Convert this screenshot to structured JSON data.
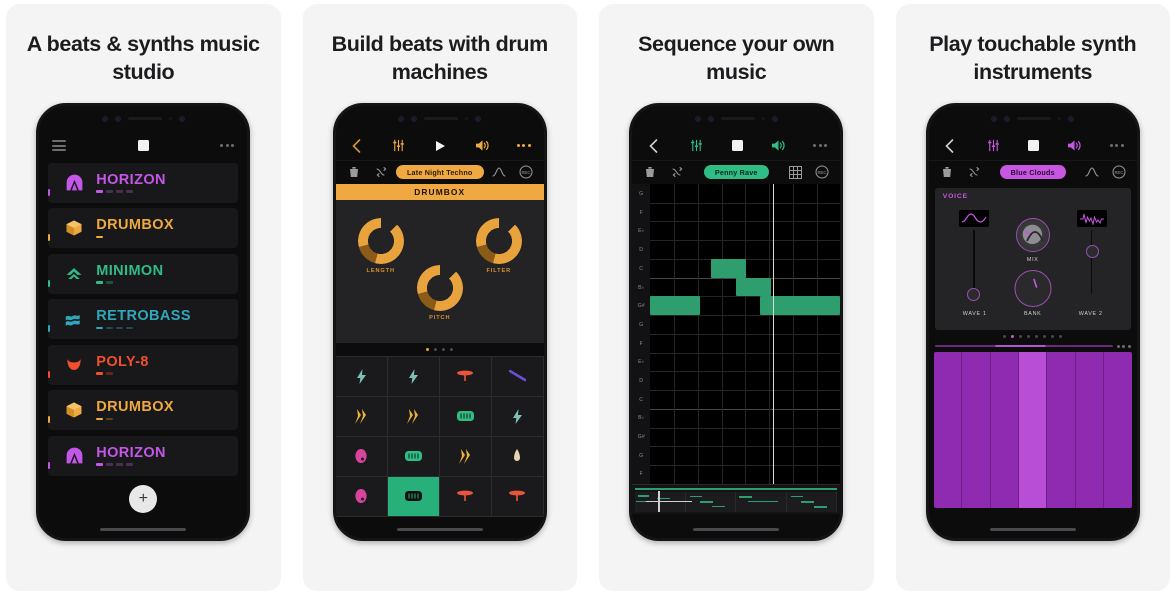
{
  "cards": [
    {
      "headline": "A beats & synths\nmusic studio",
      "screen": "instrument-list",
      "nav": {
        "menu_icon": "hamburger-icon",
        "transport_icon": "stop-square-icon",
        "more_icon": "more-dots-icon"
      },
      "instruments": [
        {
          "name": "HORIZON",
          "color": "#c357e8",
          "icon": "horizon-arch-icon",
          "ticks": 4
        },
        {
          "name": "DRUMBOX",
          "color": "#efa940",
          "icon": "drumbox-cube-icon",
          "ticks": 1
        },
        {
          "name": "MINIMON",
          "color": "#2fbd85",
          "icon": "minimon-chevron-icon",
          "ticks": 2
        },
        {
          "name": "RETROBASS",
          "color": "#2fa7bd",
          "icon": "retrobass-waves-icon",
          "ticks": 4
        },
        {
          "name": "POLY-8",
          "color": "#f0502e",
          "icon": "poly8-blob-icon",
          "ticks": 2
        },
        {
          "name": "DRUMBOX",
          "color": "#efa940",
          "icon": "drumbox-cube-icon",
          "ticks": 2
        },
        {
          "name": "HORIZON",
          "color": "#c357e8",
          "icon": "horizon-arch-icon",
          "ticks": 4
        }
      ],
      "add_button_label": "+"
    },
    {
      "headline": "Build beats with\ndrum machines",
      "screen": "drum-machine",
      "accent": "#efa940",
      "nav": {
        "back_icon": "chevron-left-icon",
        "mixer_icon": "mixer-sliders-icon",
        "transport_icon": "play-icon",
        "volume_icon": "speaker-icon",
        "more_icon": "more-dots-icon"
      },
      "toolbar": {
        "trash_icon": "trash-icon",
        "shuffle_icon": "shuffle-arrows-icon",
        "preset_label": "Late Night Techno",
        "curve_icon": "envelope-curve-icon",
        "rec_label": "REC"
      },
      "section_title": "DRUMBOX",
      "knobs": [
        {
          "label": "LENGTH"
        },
        {
          "label": "FILTER"
        },
        {
          "label": "PITCH"
        }
      ],
      "page_dots": 4,
      "page_active": 1,
      "pads": [
        {
          "icon": "lightning-icon",
          "color": "#7fbfb5"
        },
        {
          "icon": "lightning-icon",
          "color": "#7fbfb5"
        },
        {
          "icon": "cymbal-icon",
          "color": "#e8553b"
        },
        {
          "icon": "stick-icon",
          "color": "#6b4fd8"
        },
        {
          "icon": "clap-icon",
          "color": "#e8b33c"
        },
        {
          "icon": "clap-icon",
          "color": "#e8b33c"
        },
        {
          "icon": "snare-icon",
          "color": "#2fbd85"
        },
        {
          "icon": "lightning-icon",
          "color": "#7fbfb5"
        },
        {
          "icon": "kick-icon",
          "color": "#d8439e"
        },
        {
          "icon": "snare-icon",
          "color": "#2fbd85"
        },
        {
          "icon": "clap-icon",
          "color": "#e8b33c"
        },
        {
          "icon": "shaker-icon",
          "color": "#e8d4b0"
        },
        {
          "icon": "kick-icon",
          "color": "#d8439e"
        },
        {
          "icon": "snare-icon",
          "color": "#101012",
          "active": true
        },
        {
          "icon": "cymbal-icon",
          "color": "#e8553b"
        },
        {
          "icon": "cymbal-icon",
          "color": "#e8553b"
        }
      ]
    },
    {
      "headline": "Sequence your\nown music",
      "screen": "sequencer",
      "accent": "#2fbd85",
      "nav": {
        "back_icon": "chevron-left-icon",
        "mixer_icon": "mixer-sliders-icon",
        "transport_icon": "stop-square-icon",
        "volume_icon": "speaker-icon",
        "more_icon": "more-dots-icon"
      },
      "toolbar": {
        "trash_icon": "trash-icon",
        "shuffle_icon": "shuffle-arrows-icon",
        "preset_label": "Penny Rave",
        "grid_icon": "grid-icon",
        "rec_label": "REC"
      },
      "key_labels": [
        "G",
        "F",
        "E♭",
        "D",
        "C",
        "B♭",
        "G#",
        "G",
        "F",
        "E♭",
        "D",
        "C",
        "B♭",
        "G#",
        "G",
        "F"
      ],
      "notes": [
        {
          "row": 6,
          "start": 0.0,
          "span": 2.1
        },
        {
          "row": 4,
          "start": 2.55,
          "span": 1.5
        },
        {
          "row": 5,
          "start": 3.6,
          "span": 1.5
        },
        {
          "row": 6,
          "start": 4.6,
          "span": 3.4
        }
      ],
      "playhead_position": 0.645,
      "mini_timeline_bars": 4
    },
    {
      "headline": "Play touchable\nsynth instruments",
      "screen": "synth",
      "accent": "#c757e0",
      "nav": {
        "back_icon": "chevron-left-icon",
        "mixer_icon": "mixer-sliders-icon",
        "transport_icon": "stop-square-icon",
        "volume_icon": "speaker-icon",
        "more_icon": "more-dots-icon"
      },
      "toolbar": {
        "trash_icon": "trash-icon",
        "shuffle_icon": "shuffle-arrows-icon",
        "preset_label": "Blue Clouds",
        "curve_icon": "envelope-curve-icon",
        "rec_label": "REC"
      },
      "panel_title": "VOICE",
      "controls": [
        {
          "label": "WAVE 1",
          "type": "slider"
        },
        {
          "label": "MIX",
          "type": "knob"
        },
        {
          "label": "BANK",
          "type": "knob"
        },
        {
          "label": "WAVE 2",
          "type": "slider"
        }
      ],
      "page_dots": 8,
      "page_active": 1,
      "keys": 7,
      "key_lit_index": 3
    }
  ]
}
